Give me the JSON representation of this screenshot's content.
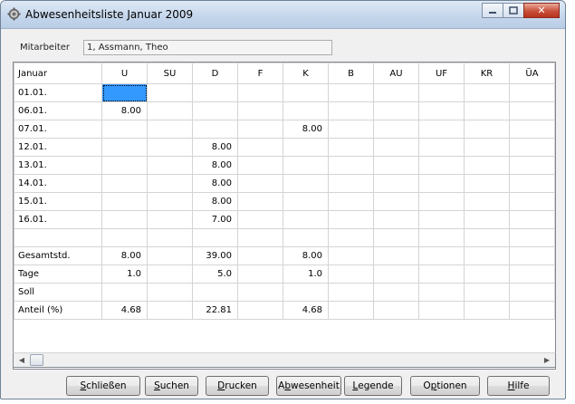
{
  "window": {
    "title": "Abwesenheitsliste Januar 2009",
    "controls": {
      "minimize_icon": "minimize-icon",
      "maximize_icon": "maximize-icon",
      "close_icon": "close-icon"
    }
  },
  "employee": {
    "label": "Mitarbeiter",
    "value": "1, Assmann, Theo"
  },
  "grid": {
    "columns": [
      "Januar",
      "U",
      "SU",
      "D",
      "F",
      "K",
      "B",
      "AU",
      "UF",
      "KR",
      "ÜA"
    ],
    "rows": [
      [
        "01.01.",
        "",
        "",
        "",
        "",
        "",
        "",
        "",
        "",
        "",
        ""
      ],
      [
        "06.01.",
        "8.00",
        "",
        "",
        "",
        "",
        "",
        "",
        "",
        "",
        ""
      ],
      [
        "07.01.",
        "",
        "",
        "",
        "",
        "8.00",
        "",
        "",
        "",
        "",
        ""
      ],
      [
        "12.01.",
        "",
        "",
        "8.00",
        "",
        "",
        "",
        "",
        "",
        "",
        ""
      ],
      [
        "13.01.",
        "",
        "",
        "8.00",
        "",
        "",
        "",
        "",
        "",
        "",
        ""
      ],
      [
        "14.01.",
        "",
        "",
        "8.00",
        "",
        "",
        "",
        "",
        "",
        "",
        ""
      ],
      [
        "15.01.",
        "",
        "",
        "8.00",
        "",
        "",
        "",
        "",
        "",
        "",
        ""
      ],
      [
        "16.01.",
        "",
        "",
        "7.00",
        "",
        "",
        "",
        "",
        "",
        "",
        ""
      ],
      [
        "",
        "",
        "",
        "",
        "",
        "",
        "",
        "",
        "",
        "",
        ""
      ],
      [
        "Gesamtstd.",
        "8.00",
        "",
        "39.00",
        "",
        "8.00",
        "",
        "",
        "",
        "",
        ""
      ],
      [
        "Tage",
        "1.0",
        "",
        "5.0",
        "",
        "1.0",
        "",
        "",
        "",
        "",
        ""
      ],
      [
        "Soll",
        "",
        "",
        "",
        "",
        "",
        "",
        "",
        "",
        "",
        ""
      ],
      [
        "Anteil (%)",
        "4.68",
        "",
        "22.81",
        "",
        "4.68",
        "",
        "",
        "",
        "",
        ""
      ]
    ]
  },
  "buttons": [
    {
      "key": "S",
      "rest": "chließen",
      "pre": "",
      "name": "schliessen-button"
    },
    {
      "key": "S",
      "rest": "uchen",
      "pre": "",
      "name": "suchen-button"
    },
    {
      "key": "D",
      "rest": "rucken",
      "pre": "",
      "name": "drucken-button"
    },
    {
      "key": "b",
      "rest": "wesenheit",
      "pre": "A",
      "name": "abwesenheit-button"
    },
    {
      "key": "L",
      "rest": "egende",
      "pre": "",
      "name": "legende-button"
    },
    {
      "key": "p",
      "rest": "tionen",
      "pre": "O",
      "name": "optionen-button"
    },
    {
      "key": "H",
      "rest": "ilfe",
      "pre": "",
      "name": "hilfe-button"
    }
  ]
}
